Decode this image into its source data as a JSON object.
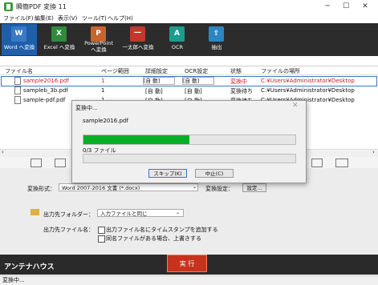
{
  "window": {
    "title": "瞬簡PDF 変換 11",
    "minimize": "─",
    "maximize": "☐",
    "close": "✕"
  },
  "menu": [
    "ファイル(F)",
    "編集(E)",
    "表示(V)",
    "ツール(T)",
    "ヘルプ(H)"
  ],
  "toolbar": [
    {
      "label": "Word へ変換",
      "icon": "word-icon",
      "glyph": "W"
    },
    {
      "label": "Excel へ変換",
      "icon": "excel-icon",
      "glyph": "X"
    },
    {
      "label": "PowerPoint へ変換",
      "icon": "powerpoint-icon",
      "glyph": "P"
    },
    {
      "label": "一太郎へ変換",
      "icon": "ichitaro-icon",
      "glyph": "一"
    },
    {
      "label": "OCR",
      "icon": "ocr-icon",
      "glyph": "A"
    },
    {
      "label": "抽出",
      "icon": "extract-icon",
      "glyph": "⇪"
    }
  ],
  "table": {
    "headers": [
      "ファイル名",
      "ページ範囲",
      "詳細設定",
      "OCR設定",
      "状態",
      "ファイルの場所"
    ],
    "rows": [
      {
        "name": "sample2016.pdf",
        "range": "1",
        "detail": "[自 動]",
        "ocr": "[自 動]",
        "status": "変換中",
        "path": "C:¥Users¥Administrator¥Desktop"
      },
      {
        "name": "sampleb_3b.pdf",
        "range": "1",
        "detail": "[自 動]",
        "ocr": "[自 動]",
        "status": "変換待ち",
        "path": "C:¥Users¥Administrator¥Desktop"
      },
      {
        "name": "sample-pdf.pdf",
        "range": "1",
        "detail": "[自 動]",
        "ocr": "[自 動]",
        "status": "変換待ち",
        "path": "C:¥Users¥Administrator¥Desktop"
      }
    ]
  },
  "options": {
    "format_label": "変換形式：",
    "format_value": "Word 2007-2016 文書 (*.docx)",
    "settings_label": "変換設定：",
    "settings_button": "設定...",
    "output_folder_label": "出力先フォルダー：",
    "output_folder_value": "入力ファイルと同じ",
    "output_name_label": "出力先ファイル名：",
    "timestamp_option": "出力ファイル名にタイムスタンプを追加する",
    "overwrite_option": "同名ファイルがある場合、上書きする"
  },
  "bottom": {
    "logo": "アンテナハウス",
    "run": "実 行"
  },
  "status": "変換中...",
  "dialog": {
    "title": "変換中...",
    "close": "✕",
    "file": "sample2016.pdf",
    "progress_fraction": 0.5,
    "count": "0/3 ファイル",
    "skip_button": "スキップ(K)",
    "stop_button": "中止(C)"
  },
  "colors": {
    "progress": "#06b025",
    "toolbar": "#2c2c2c",
    "status_active": "#d42020"
  }
}
